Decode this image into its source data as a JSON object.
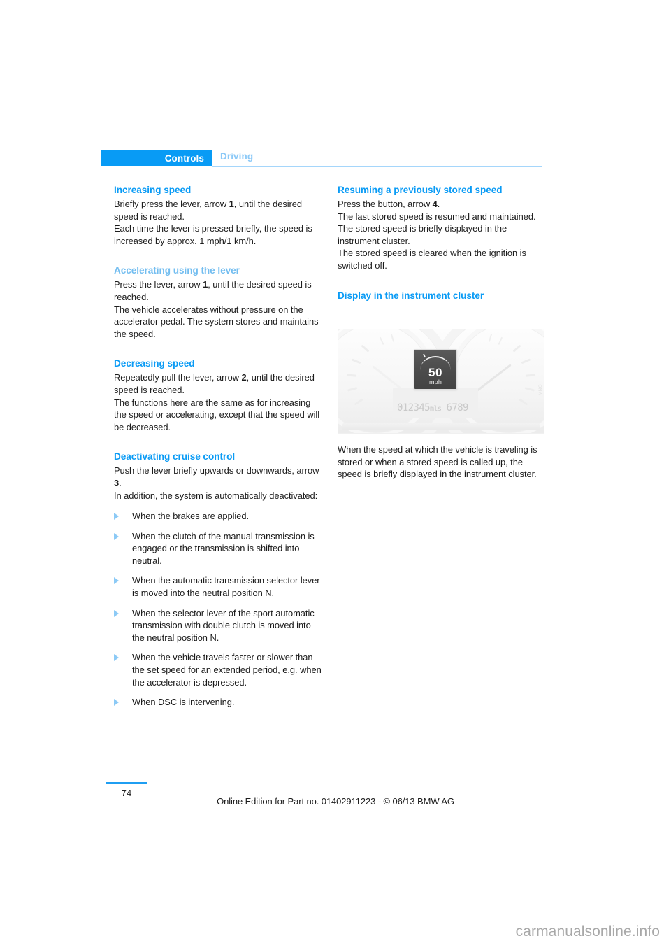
{
  "header": {
    "tab_label": "Controls",
    "section_label": "Driving"
  },
  "left_column": {
    "increasing": {
      "heading": "Increasing speed",
      "p1_a": "Briefly press the lever, arrow ",
      "p1_b": "1",
      "p1_c": ", until the desired speed is reached.",
      "p2": "Each time the lever is pressed briefly, the speed is increased by approx. 1 mph/1 km/h."
    },
    "accelerating": {
      "heading": "Accelerating using the lever",
      "p1_a": "Press the lever, arrow ",
      "p1_b": "1",
      "p1_c": ", until the desired speed is reached.",
      "p2": "The vehicle accelerates without pressure on the accelerator pedal. The system stores and maintains the speed."
    },
    "decreasing": {
      "heading": "Decreasing speed",
      "p1_a": "Repeatedly pull the lever, arrow ",
      "p1_b": "2",
      "p1_c": ", until the desired speed is reached.",
      "p2": "The functions here are the same as for increasing the speed or accelerating, except that the speed will be decreased."
    },
    "deactivating": {
      "heading": "Deactivating cruise control",
      "p1_a": "Push the lever briefly upwards or downwards, arrow ",
      "p1_b": "3",
      "p1_c": ".",
      "p2": "In addition, the system is automatically deactivated:",
      "bullets": [
        "When the brakes are applied.",
        "When the clutch of the manual transmission is engaged or the transmission is shifted into neutral.",
        "When the automatic transmission selector lever is moved into the neutral position N.",
        "When the selector lever of the sport automatic transmission with double clutch is moved into the neutral position N.",
        "When the vehicle travels faster or slower than the set speed for an extended period, e.g. when the accelerator is depressed.",
        "When DSC is intervening."
      ]
    }
  },
  "right_column": {
    "resuming": {
      "heading": "Resuming a previously stored speed",
      "p1_a": "Press the button, arrow ",
      "p1_b": "4",
      "p1_c": ".",
      "p2": "The last stored speed is resumed and maintained.",
      "p3": "The stored speed is briefly displayed in the instrument cluster.",
      "p4": "The stored speed is cleared when the ignition is switched off."
    },
    "display": {
      "heading": "Display in the instrument cluster",
      "caption": "When the speed at which the vehicle is traveling is stored or when a stored speed is called up, the speed is briefly displayed in the instrument cluster."
    }
  },
  "figure": {
    "speed_value": "50",
    "speed_unit": "mph",
    "odometer": "012345",
    "odometer_unit": "mls",
    "trip": "6789",
    "watermark": "MNO"
  },
  "footer": {
    "page_number": "74",
    "edition": "Online Edition for Part no. 01402911223 - © 06/13 BMW AG",
    "site_watermark": "carmanualsonline.info"
  },
  "colors": {
    "accent_blue": "#089bf5",
    "soft_blue": "#8cc9f7",
    "bullet_blue": "#8ccaf6"
  }
}
